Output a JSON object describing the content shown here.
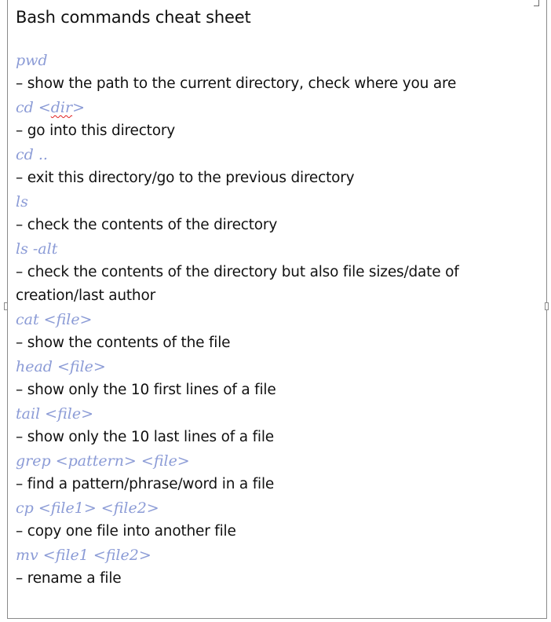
{
  "document": {
    "title": "Bash commands cheat sheet",
    "entries": [
      {
        "cmd": "pwd",
        "desc": "– show the path to the current directory, check where you are"
      },
      {
        "cmd": "cd <dir>",
        "desc": "– go into this directory"
      },
      {
        "cmd": "cd ..",
        "desc": "– exit this directory/go to the previous directory"
      },
      {
        "cmd": "ls",
        "desc": "– check the contents of the directory"
      },
      {
        "cmd": "ls -alt",
        "desc": "– check the contents of the directory but also file sizes/date of creation/last author"
      },
      {
        "cmd": "cat <file>",
        "desc": "– show the contents of the file"
      },
      {
        "cmd": "head <file>",
        "desc": "– show only the 10 first lines of a file"
      },
      {
        "cmd": "tail <file>",
        "desc": "– show only the 10 last lines of a file"
      },
      {
        "cmd": "grep <pattern> <file>",
        "desc": "– find a pattern/phrase/word in a file"
      },
      {
        "cmd": "cp <file1> <file2>",
        "desc": "– copy one file into another file"
      },
      {
        "cmd": "mv <file1 <file2>",
        "desc": "– rename a file"
      }
    ]
  },
  "colors": {
    "command_text": "#8b9bd6",
    "body_text": "#111111",
    "spellcheck_underline": "#e02020"
  }
}
